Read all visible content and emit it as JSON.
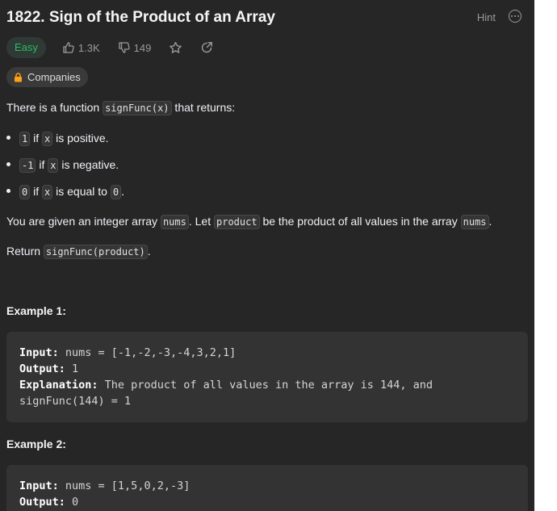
{
  "problem": {
    "title": "1822. Sign of the Product of an Array",
    "hint_label": "Hint",
    "difficulty": "Easy",
    "likes": "1.3K",
    "dislikes": "149",
    "companies_label": "Companies"
  },
  "description": {
    "intro_pre": "There is a function ",
    "intro_code": "signFunc(x)",
    "intro_post": " that returns:",
    "bullets": [
      {
        "code1": "1",
        "mid": " if ",
        "code2": "x",
        "post": " is positive."
      },
      {
        "code1": "-1",
        "mid": " if ",
        "code2": "x",
        "post": " is negative."
      },
      {
        "code1": "0",
        "mid": " if ",
        "code2": "x",
        "post": " is equal to ",
        "code3": "0",
        "end": "."
      }
    ],
    "given_pre": "You are given an integer array ",
    "given_code1": "nums",
    "given_mid1": ". Let ",
    "given_code2": "product",
    "given_mid2": " be the product of all values in the array ",
    "given_code3": "nums",
    "given_end": ".",
    "return_pre": "Return ",
    "return_code": "signFunc(product)",
    "return_end": "."
  },
  "examples": [
    {
      "title": "Example 1:",
      "input_label": "Input:",
      "input": " nums = [-1,-2,-3,-4,3,2,1]",
      "output_label": "Output:",
      "output": " 1",
      "explanation_label": "Explanation:",
      "explanation_1": " The product of all values in the array is 144, and",
      "explanation_2": "signFunc(144) = 1"
    },
    {
      "title": "Example 2:",
      "input_label": "Input:",
      "input": " nums = [1,5,0,2,-3]",
      "output_label": "Output:",
      "output": " 0"
    }
  ],
  "colors": {
    "panel_bg": "#262626",
    "easy_green": "#2cbb5d",
    "lock_orange": "#ffa116"
  }
}
